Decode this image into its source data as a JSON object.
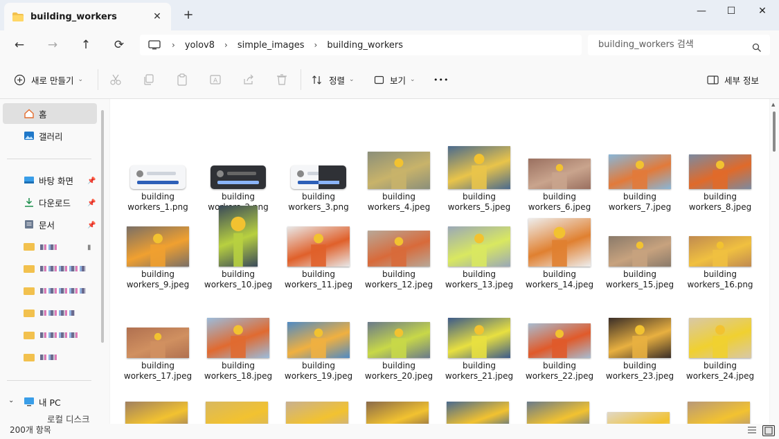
{
  "window": {
    "tab_title": "building_workers",
    "close_tab": "✕",
    "new_tab": "+",
    "minimize": "—",
    "maximize": "☐",
    "close": "✕"
  },
  "nav": {
    "back": "←",
    "forward": "→",
    "up": "↑",
    "refresh": "⟳",
    "breadcrumbs": [
      "yolov8",
      "simple_images",
      "building_workers"
    ],
    "breadcrumb_separator": "›",
    "search_placeholder": "building_workers 검색"
  },
  "commandbar": {
    "new_label": "새로 만들기",
    "sort_label": "정렬",
    "view_label": "보기",
    "more": "•••",
    "details_label": "세부 정보"
  },
  "sidebar": {
    "home": "홈",
    "gallery": "갤러리",
    "desktop": "바탕 화면",
    "downloads": "다운로드",
    "documents": "문서",
    "this_pc": "내 PC",
    "partial_item": "로컬 디스크 (C:"
  },
  "files": [
    {
      "name": "building workers_1.png"
    },
    {
      "name": "building workers_2.png"
    },
    {
      "name": "building workers_3.png"
    },
    {
      "name": "building workers_4.jpeg"
    },
    {
      "name": "building workers_5.jpeg"
    },
    {
      "name": "building workers_6.jpeg"
    },
    {
      "name": "building workers_7.jpeg"
    },
    {
      "name": "building workers_8.jpeg"
    },
    {
      "name": "building workers_9.jpeg"
    },
    {
      "name": "building workers_10.jpeg"
    },
    {
      "name": "building workers_11.jpeg"
    },
    {
      "name": "building workers_12.jpeg"
    },
    {
      "name": "building workers_13.jpeg"
    },
    {
      "name": "building workers_14.jpeg"
    },
    {
      "name": "building workers_15.jpeg"
    },
    {
      "name": "building workers_16.png"
    },
    {
      "name": "building workers_17.jpeg"
    },
    {
      "name": "building workers_18.jpeg"
    },
    {
      "name": "building workers_19.jpeg"
    },
    {
      "name": "building workers_20.jpeg"
    },
    {
      "name": "building workers_21.jpeg"
    },
    {
      "name": "building workers_22.jpeg"
    },
    {
      "name": "building workers_23.jpeg"
    },
    {
      "name": "building workers_24.jpeg"
    }
  ],
  "status": {
    "item_count": "200개 항목"
  },
  "colors": {
    "folder": "#f2c14e",
    "accent": "#0067c0",
    "selected_bg": "#e0e0e0"
  }
}
